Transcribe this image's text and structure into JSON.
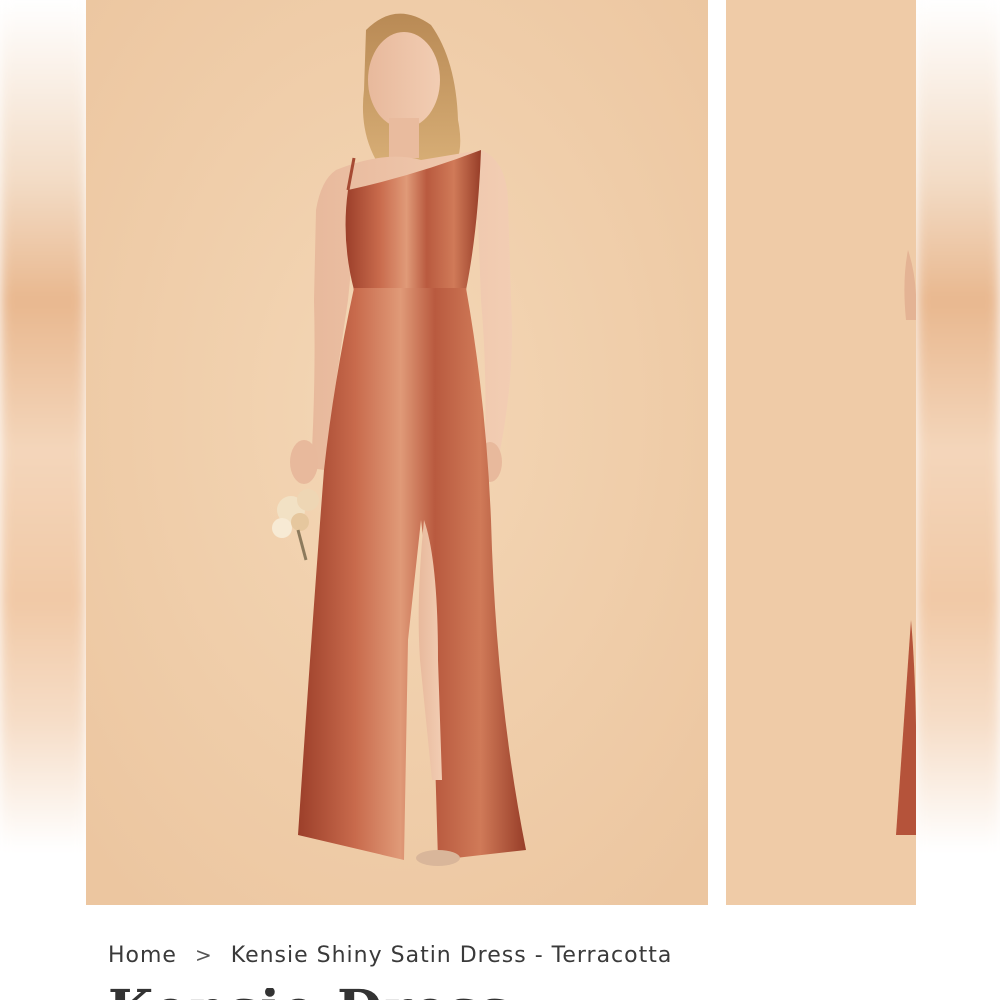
{
  "breadcrumb": {
    "home_label": "Home",
    "separator": ">",
    "current": "Kensie Shiny Satin Dress - Terracotta"
  },
  "product": {
    "title_partial": "Kensie Dress",
    "main_image_alt": "Model in terracotta one-shoulder satin dress holding a small bouquet",
    "secondary_image_alt": "Partial view of the terracotta dress"
  },
  "colors": {
    "backdrop": "#f0cfac",
    "dress": "#b5533a",
    "text": "#3a3a3a"
  }
}
